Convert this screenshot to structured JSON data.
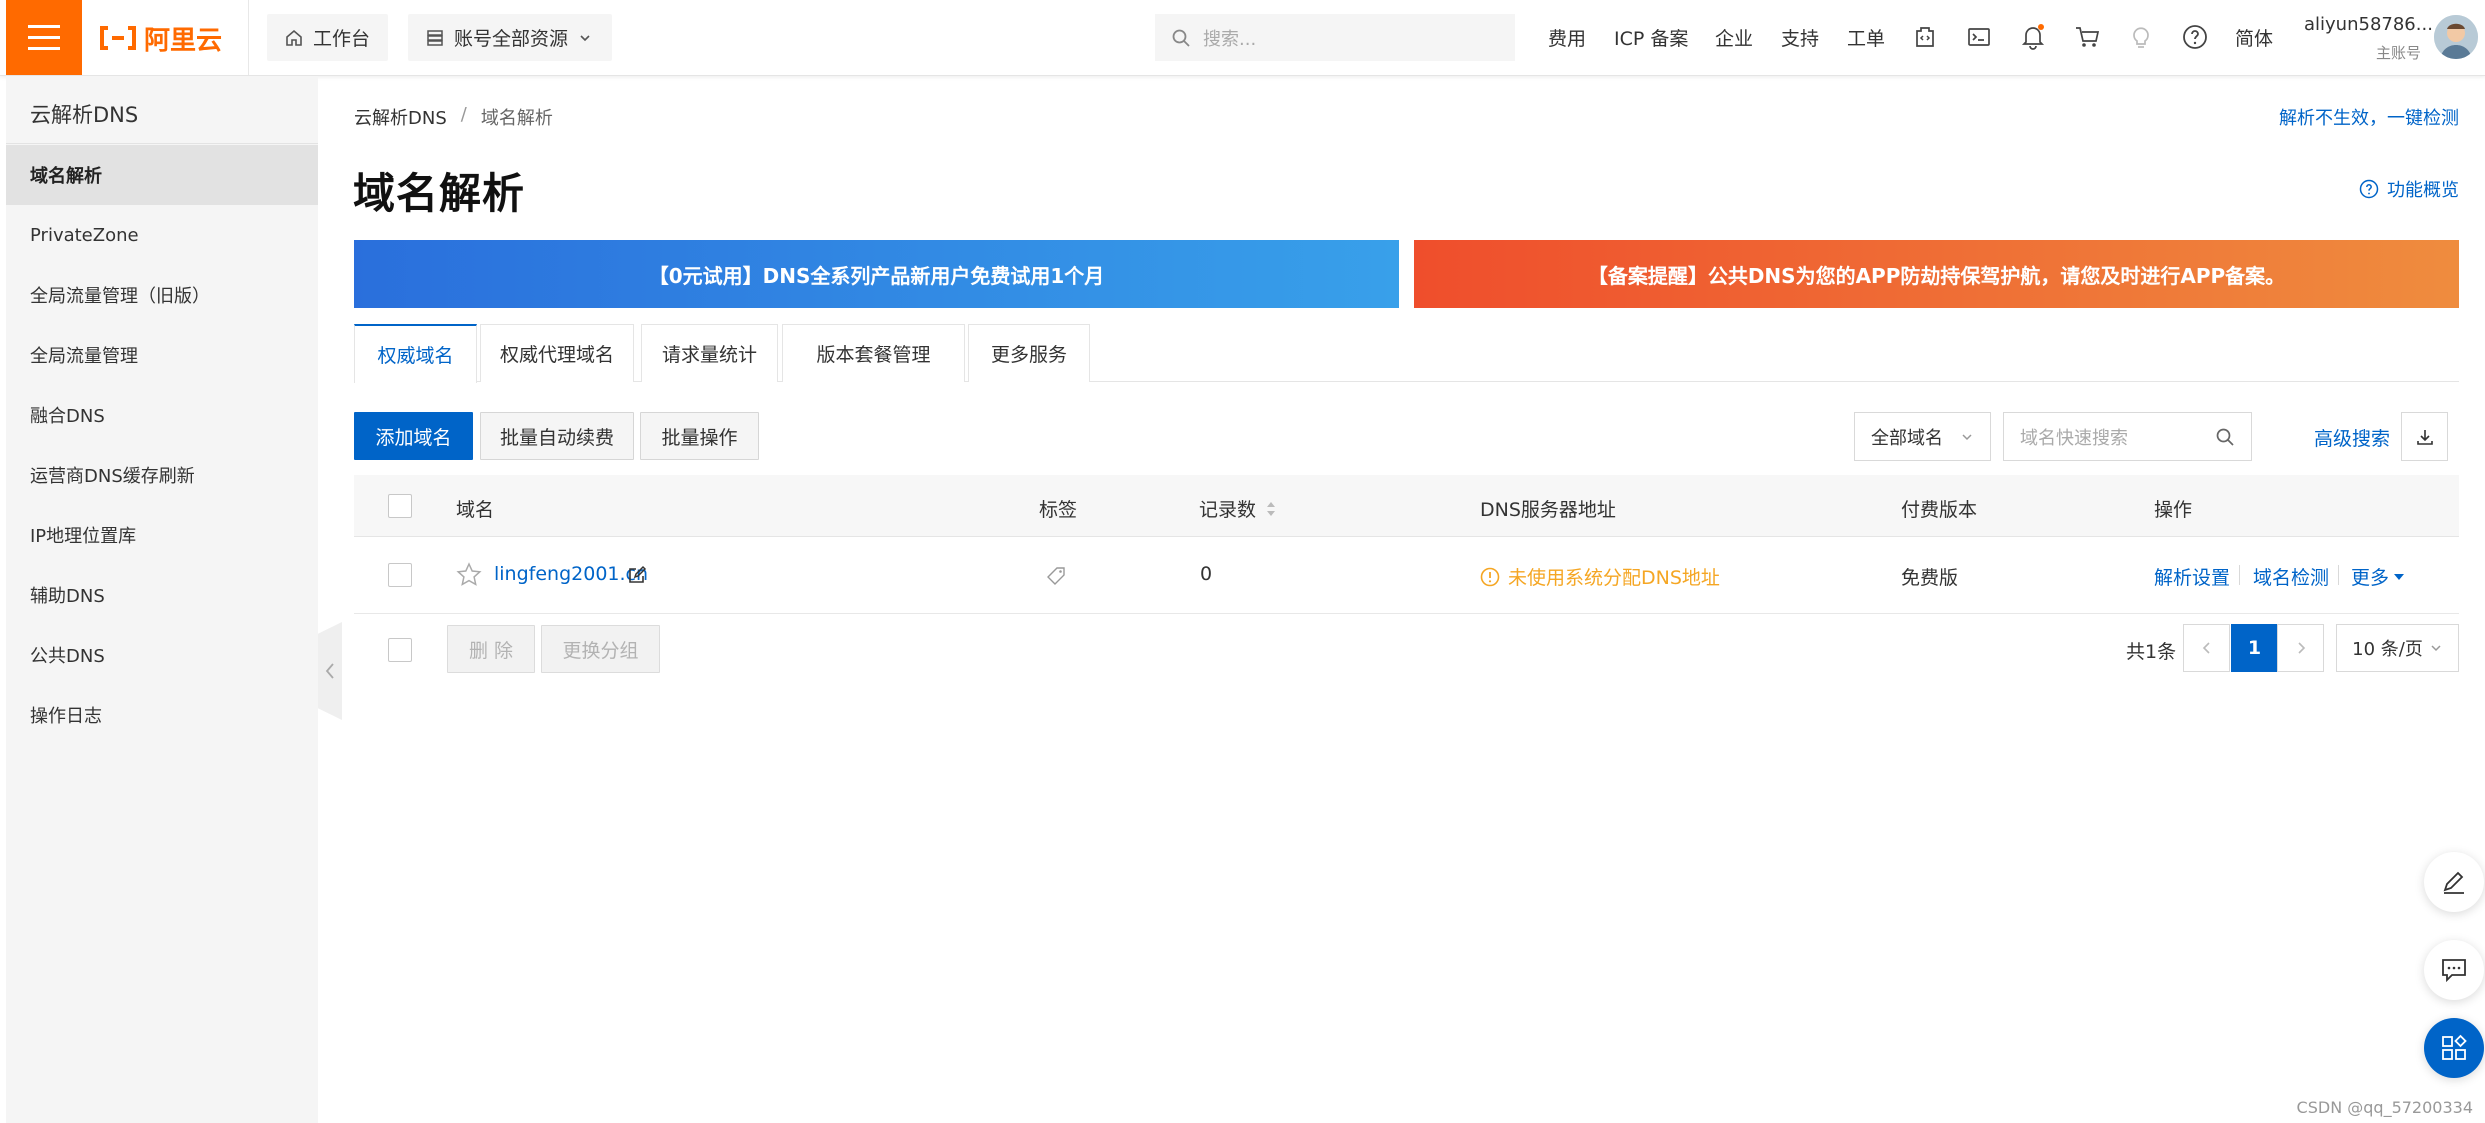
{
  "topbar": {
    "logo_text": "阿里云",
    "workbench": "工作台",
    "resources": "账号全部资源",
    "search_placeholder": "搜索...",
    "links": [
      "费用",
      "ICP 备案",
      "企业",
      "支持",
      "工单"
    ],
    "lang": "简体",
    "user_name": "aliyun58786...",
    "user_role": "主账号",
    "notification_dot_color": "#ff6a00"
  },
  "sidebar": {
    "title": "云解析DNS",
    "items": [
      {
        "label": "域名解析",
        "active": true
      },
      {
        "label": "PrivateZone"
      },
      {
        "label": "全局流量管理（旧版）"
      },
      {
        "label": "全局流量管理"
      },
      {
        "label": "融合DNS"
      },
      {
        "label": "运营商DNS缓存刷新"
      },
      {
        "label": "IP地理位置库"
      },
      {
        "label": "辅助DNS"
      },
      {
        "label": "公共DNS"
      },
      {
        "label": "操作日志"
      }
    ]
  },
  "main": {
    "breadcrumb": [
      "云解析DNS",
      "域名解析"
    ],
    "breadcrumb_sep": "/",
    "check_link": "解析不生效，一键检测",
    "title": "域名解析",
    "overview_link": "功能概览",
    "banners": [
      {
        "text": "【0元试用】DNS全系列产品新用户免费试用1个月",
        "color": "#2a6fdc"
      },
      {
        "text": "【备案提醒】公共DNS为您的APP防劫持保驾护航，请您及时进行APP备案。",
        "color": "#ef4e2c"
      }
    ],
    "tabs": [
      "权威域名",
      "权威代理域名",
      "请求量统计",
      "版本套餐管理",
      "更多服务"
    ],
    "active_tab": "权威域名",
    "toolbar": {
      "add_domain": "添加域名",
      "batch_renew": "批量自动续费",
      "batch_ops": "批量操作",
      "filter_select": "全部域名",
      "search_placeholder": "域名快速搜索",
      "advanced_search": "高级搜索"
    },
    "table": {
      "columns": [
        "域名",
        "标签",
        "记录数",
        "DNS服务器地址",
        "付费版本",
        "操作"
      ],
      "rows": [
        {
          "domain": "lingfeng2001.cn",
          "records": "0",
          "dns_status": "未使用系统分配DNS地址",
          "plan": "免费版",
          "actions": [
            "解析设置",
            "域名检测",
            "更多"
          ]
        }
      ]
    },
    "footer": {
      "delete": "删 除",
      "change_group": "更换分组",
      "total": "共1条",
      "current_page": "1",
      "page_size": "10 条/页"
    }
  },
  "accent_color": "#0064c8",
  "warning_color": "#f5a623",
  "watermark": "CSDN @qq_57200334"
}
